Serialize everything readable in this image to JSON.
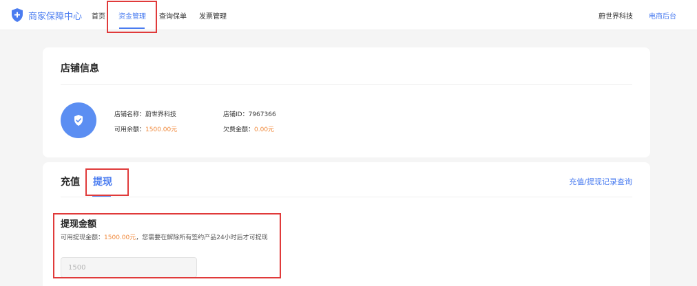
{
  "header": {
    "brand_title": "商家保障中心",
    "nav": [
      {
        "label": "首页",
        "active": false
      },
      {
        "label": "资金管理",
        "active": true
      },
      {
        "label": "查询保单",
        "active": false
      },
      {
        "label": "发票管理",
        "active": false
      }
    ],
    "shop_name": "蔚世界科技",
    "backend_link": "电商后台"
  },
  "shop_info": {
    "title": "店铺信息",
    "name_label": "店铺名称：",
    "name_value": "蔚世界科技",
    "id_label": "店铺ID：",
    "id_value": "7967366",
    "balance_label": "可用余额：",
    "balance_value": "1500.00元",
    "arrears_label": "欠费金额：",
    "arrears_value": "0.00元"
  },
  "funds": {
    "tabs": [
      {
        "label": "充值",
        "active": false
      },
      {
        "label": "提现",
        "active": true
      }
    ],
    "record_link": "充值/提现记录查询",
    "withdraw_title": "提现金额",
    "hint_prefix": "可用提现金额：",
    "hint_amount": "1500.00元",
    "hint_suffix": "，您需要在解除所有签约产品24小时后才可提现",
    "input_placeholder": "1500"
  },
  "colors": {
    "accent": "#4a7cf0",
    "highlight": "#f0883a",
    "annotation": "#e03a3a"
  }
}
